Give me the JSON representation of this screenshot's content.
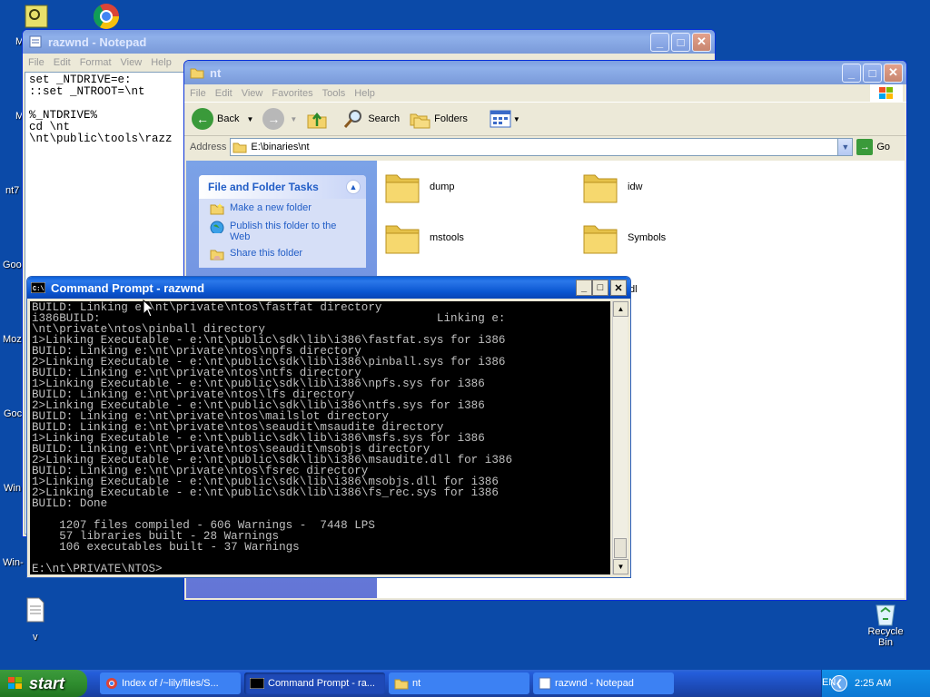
{
  "desktop": {
    "left_labels": [
      "M",
      "M",
      "nt7",
      "Goo",
      "Moz",
      "Goc",
      "Win",
      "Win-",
      "v"
    ],
    "recycle_bin": "Recycle Bin"
  },
  "notepad": {
    "title": "razwnd - Notepad",
    "menu": [
      "File",
      "Edit",
      "Format",
      "View",
      "Help"
    ],
    "text": "set _NTDRIVE=e:\n::set _NTROOT=\\nt\n\n%_NTDRIVE%\ncd \\nt\n\\nt\\public\\tools\\razz"
  },
  "explorer": {
    "title": "nt",
    "menu": [
      "File",
      "Edit",
      "View",
      "Favorites",
      "Tools",
      "Help"
    ],
    "toolbar": {
      "back": "Back",
      "search": "Search",
      "folders": "Folders"
    },
    "address_label": "Address",
    "address_value": "E:\\binaries\\nt",
    "go": "Go",
    "task_header": "File and Folder Tasks",
    "tasks": [
      "Make a new folder",
      "Publish this folder to the Web",
      "Share this folder"
    ],
    "folders": [
      "dump",
      "idw",
      "mstools",
      "Symbols"
    ],
    "partial_folder": "dl"
  },
  "cmd": {
    "title": "Command Prompt - razwnd",
    "output": "BUILD: Linking e:\\nt\\private\\ntos\\fastfat directory\ni386BUILD:                                                 Linking e:\n\\nt\\private\\ntos\\pinball directory\n1>Linking Executable - e:\\nt\\public\\sdk\\lib\\i386\\fastfat.sys for i386\nBUILD: Linking e:\\nt\\private\\ntos\\npfs directory\n2>Linking Executable - e:\\nt\\public\\sdk\\lib\\i386\\pinball.sys for i386\nBUILD: Linking e:\\nt\\private\\ntos\\ntfs directory\n1>Linking Executable - e:\\nt\\public\\sdk\\lib\\i386\\npfs.sys for i386\nBUILD: Linking e:\\nt\\private\\ntos\\lfs directory\n2>Linking Executable - e:\\nt\\public\\sdk\\lib\\i386\\ntfs.sys for i386\nBUILD: Linking e:\\nt\\private\\ntos\\mailslot directory\nBUILD: Linking e:\\nt\\private\\ntos\\seaudit\\msaudite directory\n1>Linking Executable - e:\\nt\\public\\sdk\\lib\\i386\\msfs.sys for i386\nBUILD: Linking e:\\nt\\private\\ntos\\seaudit\\msobjs directory\n2>Linking Executable - e:\\nt\\public\\sdk\\lib\\i386\\msaudite.dll for i386\nBUILD: Linking e:\\nt\\private\\ntos\\fsrec directory\n1>Linking Executable - e:\\nt\\public\\sdk\\lib\\i386\\msobjs.dll for i386\n2>Linking Executable - e:\\nt\\public\\sdk\\lib\\i386\\fs_rec.sys for i386\nBUILD: Done\n\n    1207 files compiled - 606 Warnings -  7448 LPS\n    57 libraries built - 28 Warnings\n    106 executables built - 37 Warnings\n\nE:\\nt\\PRIVATE\\NTOS>"
  },
  "taskbar": {
    "start": "start",
    "items": [
      "Index of /~lily/files/S...",
      "Command Prompt - ra...",
      "nt",
      "razwnd - Notepad"
    ],
    "lang": "EN",
    "clock": "2:25 AM"
  },
  "colors": {
    "desktop": "#0b4aa8",
    "xp_blue": "#0a55d0",
    "start_green": "#2f8d2f",
    "link": "#215dc6"
  }
}
